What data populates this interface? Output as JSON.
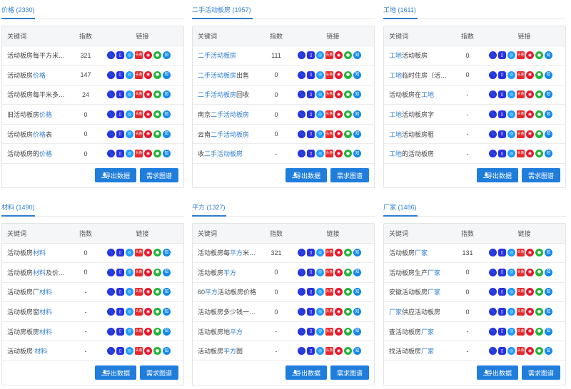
{
  "labels": {
    "col_keyword": "关键词",
    "col_index": "指数",
    "col_links": "链接",
    "export_button": "导出数据",
    "demand_map_button": "需求图谱"
  },
  "link_icons": [
    {
      "name": "baidu-icon",
      "glyph": "🐾",
      "class": "ic-baidu"
    },
    {
      "name": "baidu-mobile-icon",
      "glyph": "▯",
      "class": "ic-mobile"
    },
    {
      "name": "search-360-icon",
      "glyph": "◎",
      "class": "ic-360"
    },
    {
      "name": "toutiao-icon",
      "glyph": "头条",
      "class": "ic-toutiao"
    },
    {
      "name": "weibo-icon",
      "glyph": "◉",
      "class": "ic-weibo"
    },
    {
      "name": "wechat-icon",
      "glyph": "●",
      "class": "ic-wechat"
    },
    {
      "name": "zhihu-icon",
      "glyph": "知",
      "class": "ic-zhihu"
    }
  ],
  "colors": {
    "accent": "#2f7dd1",
    "button": "#1f7ddc"
  },
  "panels": [
    {
      "title": "价格 (2330)",
      "rows": [
        {
          "keyword": [
            {
              "t": "活动板房每平方米多少钱",
              "hl": false
            }
          ],
          "index": "321"
        },
        {
          "keyword": [
            {
              "t": "活动板房",
              "hl": false
            },
            {
              "t": "价格",
              "hl": true
            }
          ],
          "index": "147"
        },
        {
          "keyword": [
            {
              "t": "活动板房每平米多少钱",
              "hl": false
            }
          ],
          "index": "24"
        },
        {
          "keyword": [
            {
              "t": "旧活动板房",
              "hl": false
            },
            {
              "t": "价格",
              "hl": true
            }
          ],
          "index": "0"
        },
        {
          "keyword": [
            {
              "t": "活动板房",
              "hl": false
            },
            {
              "t": "价格",
              "hl": true
            },
            {
              "t": "表",
              "hl": false
            }
          ],
          "index": "0"
        },
        {
          "keyword": [
            {
              "t": "活动板房的",
              "hl": false
            },
            {
              "t": "价格",
              "hl": true
            }
          ],
          "index": "0"
        }
      ]
    },
    {
      "title": "二手活动板房 (1957)",
      "rows": [
        {
          "keyword": [
            {
              "t": "二手活动板房",
              "hl": true
            }
          ],
          "index": "111"
        },
        {
          "keyword": [
            {
              "t": "二手活动板房",
              "hl": true
            },
            {
              "t": "出售",
              "hl": false
            }
          ],
          "index": "0"
        },
        {
          "keyword": [
            {
              "t": "二手活动板房",
              "hl": true
            },
            {
              "t": "回收",
              "hl": false
            }
          ],
          "index": "0"
        },
        {
          "keyword": [
            {
              "t": "南京",
              "hl": false
            },
            {
              "t": "二手活动板房",
              "hl": true
            }
          ],
          "index": "0"
        },
        {
          "keyword": [
            {
              "t": "云南",
              "hl": false
            },
            {
              "t": "二手活动板房",
              "hl": true
            }
          ],
          "index": "0"
        },
        {
          "keyword": [
            {
              "t": "收",
              "hl": false
            },
            {
              "t": "二手活动板房",
              "hl": true
            }
          ],
          "index": "-"
        }
      ]
    },
    {
      "title": "工地 (1611)",
      "rows": [
        {
          "keyword": [
            {
              "t": "工地",
              "hl": true
            },
            {
              "t": "活动板房",
              "hl": false
            }
          ],
          "index": "0"
        },
        {
          "keyword": [
            {
              "t": "工地",
              "hl": true
            },
            {
              "t": "临时住房（活动板房）",
              "hl": false
            }
          ],
          "index": "0"
        },
        {
          "keyword": [
            {
              "t": "活动板房在",
              "hl": false
            },
            {
              "t": "工地",
              "hl": true
            }
          ],
          "index": "-"
        },
        {
          "keyword": [
            {
              "t": "工地",
              "hl": true
            },
            {
              "t": "活动板房字",
              "hl": false
            }
          ],
          "index": "-"
        },
        {
          "keyword": [
            {
              "t": "工地",
              "hl": true
            },
            {
              "t": "活动板房租",
              "hl": false
            }
          ],
          "index": "-"
        },
        {
          "keyword": [
            {
              "t": "工地",
              "hl": true
            },
            {
              "t": "的活动板房",
              "hl": false
            }
          ],
          "index": "-"
        }
      ]
    },
    {
      "title": "材料 (1490)",
      "rows": [
        {
          "keyword": [
            {
              "t": "活动板房",
              "hl": false
            },
            {
              "t": "材料",
              "hl": true
            }
          ],
          "index": "0"
        },
        {
          "keyword": [
            {
              "t": "活动板房",
              "hl": false
            },
            {
              "t": "材料",
              "hl": true
            },
            {
              "t": "及价格表",
              "hl": false
            }
          ],
          "index": "0"
        },
        {
          "keyword": [
            {
              "t": "活动板房厂",
              "hl": false
            },
            {
              "t": "材料",
              "hl": true
            }
          ],
          "index": "-"
        },
        {
          "keyword": [
            {
              "t": "活动板房窗",
              "hl": false
            },
            {
              "t": "材料",
              "hl": true
            }
          ],
          "index": "-"
        },
        {
          "keyword": [
            {
              "t": "活动房板房",
              "hl": false
            },
            {
              "t": "材料",
              "hl": true
            }
          ],
          "index": "-"
        },
        {
          "keyword": [
            {
              "t": "活动板房 ",
              "hl": false
            },
            {
              "t": "材料",
              "hl": true
            }
          ],
          "index": "-"
        }
      ]
    },
    {
      "title": "平方 (1327)",
      "rows": [
        {
          "keyword": [
            {
              "t": "活动板房每",
              "hl": false
            },
            {
              "t": "平方",
              "hl": true
            },
            {
              "t": "米多少钱",
              "hl": false
            }
          ],
          "index": "321"
        },
        {
          "keyword": [
            {
              "t": "活动板房",
              "hl": false
            },
            {
              "t": "平方",
              "hl": true
            }
          ],
          "index": "0"
        },
        {
          "keyword": [
            {
              "t": "60",
              "hl": false
            },
            {
              "t": "平方",
              "hl": true
            },
            {
              "t": "活动板房价格",
              "hl": false
            }
          ],
          "index": "0"
        },
        {
          "keyword": [
            {
              "t": "活动板房多少钱一平方",
              "hl": false
            }
          ],
          "index": "0"
        },
        {
          "keyword": [
            {
              "t": "活动板房地",
              "hl": false
            },
            {
              "t": "平方",
              "hl": true
            }
          ],
          "index": "-"
        },
        {
          "keyword": [
            {
              "t": "活动板房",
              "hl": false
            },
            {
              "t": "平方",
              "hl": true
            },
            {
              "t": "图",
              "hl": false
            }
          ],
          "index": "-"
        }
      ]
    },
    {
      "title": "厂家 (1486)",
      "rows": [
        {
          "keyword": [
            {
              "t": "活动板房",
              "hl": false
            },
            {
              "t": "厂家",
              "hl": true
            }
          ],
          "index": "131"
        },
        {
          "keyword": [
            {
              "t": "活动板房生产",
              "hl": false
            },
            {
              "t": "厂家",
              "hl": true
            }
          ],
          "index": "0"
        },
        {
          "keyword": [
            {
              "t": "安徽活动板房",
              "hl": false
            },
            {
              "t": "厂家",
              "hl": true
            }
          ],
          "index": "0"
        },
        {
          "keyword": [
            {
              "t": "厂家",
              "hl": true
            },
            {
              "t": "供应活动板房",
              "hl": false
            }
          ],
          "index": "0"
        },
        {
          "keyword": [
            {
              "t": "查活动板房",
              "hl": false
            },
            {
              "t": "厂家",
              "hl": true
            }
          ],
          "index": "-"
        },
        {
          "keyword": [
            {
              "t": "找活动板房",
              "hl": false
            },
            {
              "t": "厂家",
              "hl": true
            }
          ],
          "index": "-"
        }
      ]
    }
  ]
}
